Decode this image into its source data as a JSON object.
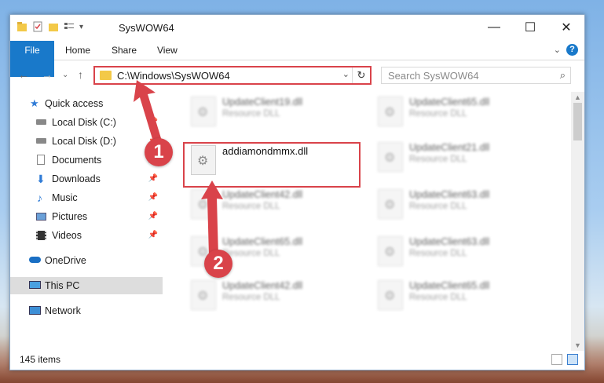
{
  "window": {
    "title": "SysWOW64",
    "controls": {
      "minimize": "—",
      "maximize": "☐",
      "close": "✕"
    }
  },
  "ribbon": {
    "tabs": [
      "File",
      "Home",
      "Share",
      "View"
    ],
    "help": "?"
  },
  "nav": {
    "address": "C:\\Windows\\SysWOW64",
    "search_placeholder": "Search SysWOW64"
  },
  "sidebar": {
    "items": [
      {
        "label": "Quick access",
        "icon": "star-icon",
        "pinned": false
      },
      {
        "label": "Local Disk (C:)",
        "icon": "drive-icon",
        "pinned": true
      },
      {
        "label": "Local Disk (D:)",
        "icon": "drive-icon",
        "pinned": true
      },
      {
        "label": "Documents",
        "icon": "documents-icon",
        "pinned": true
      },
      {
        "label": "Downloads",
        "icon": "downloads-icon",
        "pinned": true
      },
      {
        "label": "Music",
        "icon": "music-icon",
        "pinned": true
      },
      {
        "label": "Pictures",
        "icon": "pictures-icon",
        "pinned": true
      },
      {
        "label": "Videos",
        "icon": "videos-icon",
        "pinned": true
      },
      {
        "label": "OneDrive",
        "icon": "cloud-icon",
        "pinned": false
      },
      {
        "label": "This PC",
        "icon": "computer-icon",
        "pinned": false,
        "selected": true
      },
      {
        "label": "Network",
        "icon": "network-icon",
        "pinned": false
      }
    ]
  },
  "files": [
    {
      "name": "UpdateClient19.dll",
      "type": "Resource DLL",
      "blurred": true
    },
    {
      "name": "UpdateClient65.dll",
      "type": "Resource DLL",
      "blurred": true
    },
    {
      "name": "addiamondmmx.dll",
      "type": "",
      "blurred": false,
      "highlighted": true
    },
    {
      "name": "UpdateClient21.dll",
      "type": "Resource DLL",
      "blurred": true
    },
    {
      "name": "UpdateClient42.dll",
      "type": "Resource DLL",
      "blurred": true
    },
    {
      "name": "UpdateClient63.dll",
      "type": "Resource DLL",
      "blurred": true
    },
    {
      "name": "UpdateClient65.dll",
      "type": "Resource DLL",
      "blurred": true
    },
    {
      "name": "UpdateClient63.dll",
      "type": "Resource DLL",
      "blurred": true
    },
    {
      "name": "UpdateClient42.dll",
      "type": "Resource DLL",
      "blurred": true
    },
    {
      "name": "UpdateClient65.dll",
      "type": "Resource DLL",
      "blurred": true
    }
  ],
  "status": {
    "count": "145 items"
  },
  "annotations": {
    "step1": "1",
    "step2": "2",
    "color": "#d9434a"
  }
}
